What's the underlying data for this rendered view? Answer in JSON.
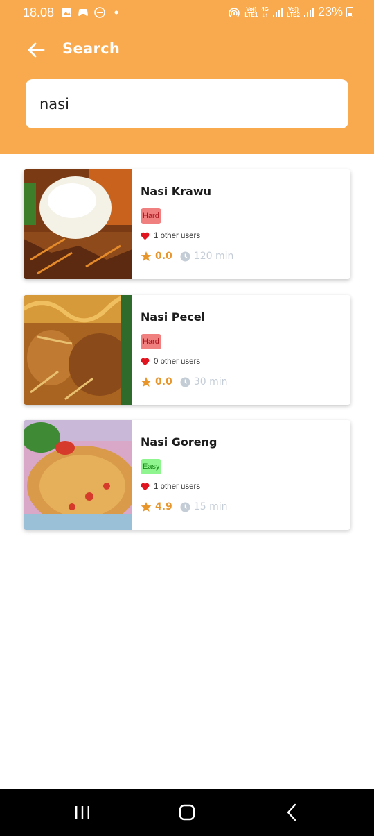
{
  "status_bar": {
    "time": "18.08",
    "sim1_top": "Vo))",
    "sim1_bottom": "LTE1",
    "data_top": "4G",
    "sim2_top": "Vo))",
    "sim2_bottom": "LTE2",
    "battery": "23%"
  },
  "header": {
    "title": "Search",
    "search_value": "nasi",
    "accent": "#F9AA4E"
  },
  "recipes": [
    {
      "name": "Nasi Krawu",
      "difficulty": "Hard",
      "likes": "1 other users",
      "rating": "0.0",
      "duration": "120 min"
    },
    {
      "name": "Nasi Pecel",
      "difficulty": "Hard",
      "likes": "0 other users",
      "rating": "0.0",
      "duration": "30 min"
    },
    {
      "name": "Nasi Goreng",
      "difficulty": "Easy",
      "likes": "1 other users",
      "rating": "4.9",
      "duration": "15 min"
    }
  ],
  "colors": {
    "hard_bg": "#F08080",
    "easy_bg": "#8FF58F",
    "rating": "#E8952A",
    "duration": "#C4CCD6",
    "heart": "#E0151F"
  },
  "nav": {
    "icons": [
      "recent-apps-icon",
      "home-icon",
      "back-icon"
    ]
  }
}
